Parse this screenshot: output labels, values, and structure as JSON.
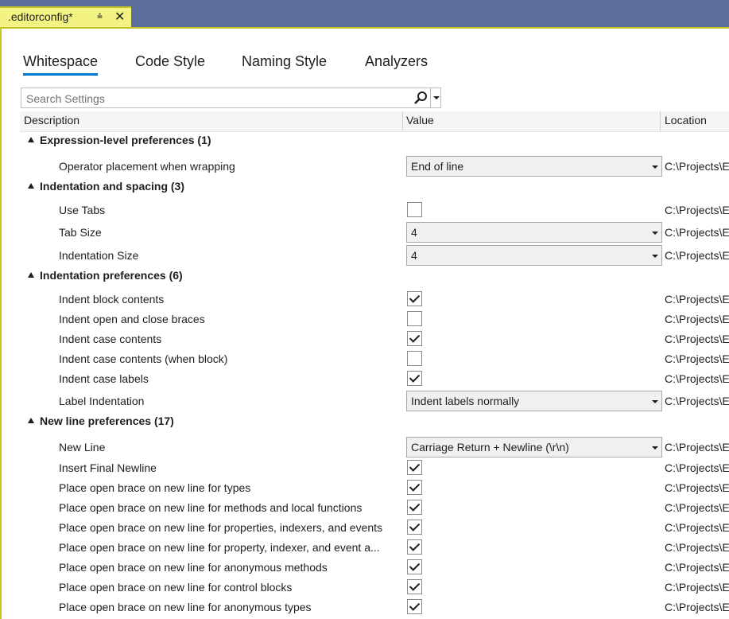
{
  "document_tab": {
    "title": ".editorconfig*"
  },
  "subtabs": [
    "Whitespace",
    "Code Style",
    "Naming Style",
    "Analyzers"
  ],
  "search": {
    "placeholder": "Search Settings"
  },
  "columns": {
    "description": "Description",
    "value": "Value",
    "location": "Location"
  },
  "location_text": "C:\\Projects\\E",
  "groups": [
    {
      "label": "Expression-level preferences",
      "count": "(1)",
      "items": [
        {
          "label": "Operator placement when wrapping",
          "type": "select",
          "value": "End of line"
        }
      ]
    },
    {
      "label": "Indentation and spacing",
      "count": "(3)",
      "items": [
        {
          "label": "Use Tabs",
          "type": "checkbox",
          "checked": false
        },
        {
          "label": "Tab Size",
          "type": "select",
          "value": "4"
        },
        {
          "label": "Indentation Size",
          "type": "select",
          "value": "4"
        }
      ]
    },
    {
      "label": "Indentation preferences",
      "count": "(6)",
      "items": [
        {
          "label": "Indent block contents",
          "type": "checkbox",
          "checked": true
        },
        {
          "label": "Indent open and close braces",
          "type": "checkbox",
          "checked": false
        },
        {
          "label": "Indent case contents",
          "type": "checkbox",
          "checked": true
        },
        {
          "label": "Indent case contents (when block)",
          "type": "checkbox",
          "checked": false
        },
        {
          "label": "Indent case labels",
          "type": "checkbox",
          "checked": true
        },
        {
          "label": "Label Indentation",
          "type": "select",
          "value": "Indent labels normally"
        }
      ]
    },
    {
      "label": "New line preferences",
      "count": "(17)",
      "items": [
        {
          "label": "New Line",
          "type": "select",
          "value": "Carriage Return + Newline (\\r\\n)"
        },
        {
          "label": "Insert Final Newline",
          "type": "checkbox",
          "checked": true
        },
        {
          "label": "Place open brace on new line for types",
          "type": "checkbox",
          "checked": true
        },
        {
          "label": "Place open brace on new line for methods and local functions",
          "type": "checkbox",
          "checked": true
        },
        {
          "label": "Place open brace on new line for properties, indexers, and events",
          "type": "checkbox",
          "checked": true
        },
        {
          "label": "Place open brace on new line for property, indexer, and event a...",
          "type": "checkbox",
          "checked": true
        },
        {
          "label": "Place open brace on new line for anonymous methods",
          "type": "checkbox",
          "checked": true
        },
        {
          "label": "Place open brace on new line for control blocks",
          "type": "checkbox",
          "checked": true
        },
        {
          "label": "Place open brace on new line for anonymous types",
          "type": "checkbox",
          "checked": true
        }
      ]
    }
  ],
  "colors": {
    "tabstrip": "#5c6c9c",
    "active_tab": "#f3f384",
    "accent_underline": "#0078d4"
  },
  "icons": {
    "pin": "pin-icon",
    "close": "close-icon",
    "search": "search-icon"
  }
}
